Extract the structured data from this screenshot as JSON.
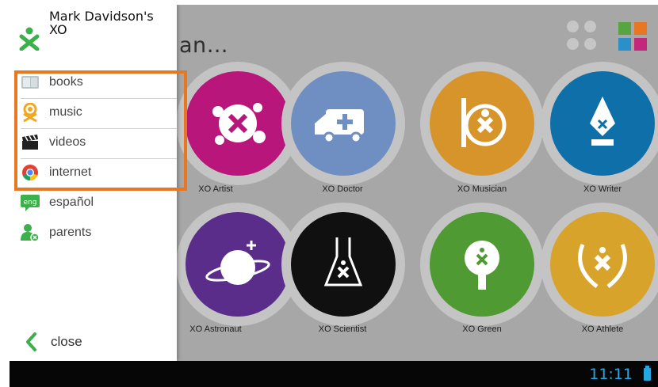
{
  "background": {
    "title": "an…",
    "tiles_row1": [
      {
        "label": "XO Artist",
        "color": "#b8167a",
        "icon": "splat-icon"
      },
      {
        "label": "XO Doctor",
        "color": "#6f8fc3",
        "icon": "ambulance-icon"
      },
      {
        "label": "XO Musician",
        "color": "#d7942a",
        "icon": "musician-icon"
      },
      {
        "label": "XO Writer",
        "color": "#0f6fa8",
        "icon": "pen-nib-icon"
      }
    ],
    "tiles_row2": [
      {
        "label": "XO Astronaut",
        "color": "#5b2d8a",
        "icon": "planet-icon"
      },
      {
        "label": "XO Scientist",
        "color": "#101010",
        "icon": "flask-icon"
      },
      {
        "label": "XO Green",
        "color": "#4f9a32",
        "icon": "tree-icon"
      },
      {
        "label": "XO Athlete",
        "color": "#d8a32a",
        "icon": "laurel-icon"
      }
    ]
  },
  "drawer": {
    "profile_name": "Mark Davidson's XO",
    "items": [
      {
        "label": "books",
        "icon": "book-icon"
      },
      {
        "label": "music",
        "icon": "music-person-icon"
      },
      {
        "label": "videos",
        "icon": "clapperboard-icon"
      },
      {
        "label": "internet",
        "icon": "chrome-icon"
      },
      {
        "label": "español",
        "icon": "language-badge-icon",
        "badge_text": "eng"
      },
      {
        "label": "parents",
        "icon": "parents-icon"
      }
    ],
    "close_label": "close"
  },
  "statusbar": {
    "time": "11:11"
  },
  "colors": {
    "accent_orange": "#e87722",
    "xo_green": "#3cb04a",
    "status_blue": "#25a7e2"
  }
}
